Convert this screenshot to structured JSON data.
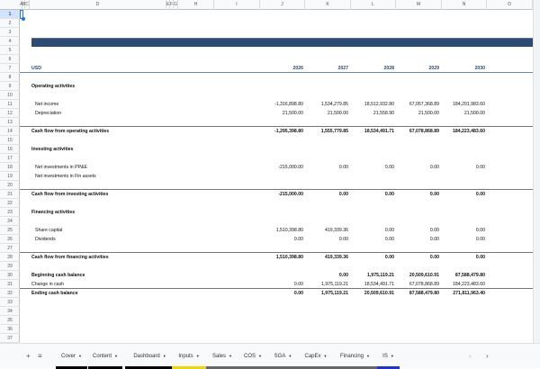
{
  "columns": [
    "A",
    "B",
    "C",
    "D",
    "E",
    "F",
    "G",
    "H",
    "I",
    "J",
    "K",
    "L",
    "M",
    "N",
    "O"
  ],
  "row_numbers": [
    1,
    2,
    3,
    4,
    5,
    6,
    7,
    8,
    9,
    10,
    11,
    12,
    13,
    14,
    15,
    16,
    17,
    18,
    19,
    20,
    21,
    22,
    23,
    24,
    25,
    26,
    27,
    28,
    29,
    30,
    31,
    32,
    33,
    34,
    35,
    36,
    37
  ],
  "title": "CASH FLOW",
  "currency": "USD",
  "years": [
    "2026",
    "2027",
    "2028",
    "2029",
    "2030"
  ],
  "rows": [
    {
      "r": 9,
      "label": "Operating activities",
      "bold": true
    },
    {
      "r": 11,
      "label": "Net income",
      "indent": true,
      "values": [
        "-1,316,898.80",
        "1,534,279.85",
        "18,512,932.80",
        "67,057,368.89",
        "184,201,983.60"
      ]
    },
    {
      "r": 12,
      "label": "Depreciation",
      "indent": true,
      "values": [
        "21,500.00",
        "21,500.00",
        "21,558.90",
        "21,500.00",
        "21,500.00"
      ]
    },
    {
      "r": 14,
      "label": "Cash flow from operating activities",
      "bold": true,
      "line": true,
      "values": [
        "-1,295,398.80",
        "1,555,779.85",
        "18,534,491.71",
        "67,078,868.89",
        "184,223,483.60"
      ]
    },
    {
      "r": 16,
      "label": "Investing activities",
      "bold": true
    },
    {
      "r": 18,
      "label": "Net investments in PP&E",
      "indent": true,
      "values": [
        "-215,000.00",
        "0.00",
        "0.00",
        "0.00",
        "0.00"
      ]
    },
    {
      "r": 19,
      "label": "Net investments in Fin assets",
      "indent": true
    },
    {
      "r": 21,
      "label": "Cash flow from investing activities",
      "bold": true,
      "line": true,
      "values": [
        "-215,000.00",
        "0.00",
        "0.00",
        "0.00",
        "0.00"
      ]
    },
    {
      "r": 23,
      "label": "Financing activities",
      "bold": true
    },
    {
      "r": 25,
      "label": "Share capital",
      "indent": true,
      "values": [
        "1,510,398.80",
        "419,339.36",
        "0.00",
        "0.00",
        "0.00"
      ]
    },
    {
      "r": 26,
      "label": "Dividends",
      "indent": true,
      "values": [
        "0.00",
        "0.00",
        "0.00",
        "0.00",
        "0.00"
      ]
    },
    {
      "r": 28,
      "label": "Cash flow from financing activities",
      "bold": true,
      "line": true,
      "values": [
        "1,510,398.80",
        "419,339.36",
        "0.00",
        "0.00",
        "0.00"
      ]
    },
    {
      "r": 30,
      "label": "Beginning cash balance",
      "bold": true,
      "values": [
        "",
        "0.00",
        "1,975,119.21",
        "20,509,610.91",
        "87,588,479.80"
      ]
    },
    {
      "r": 31,
      "label": "Change in cash",
      "values": [
        "0.00",
        "1,975,119.21",
        "18,534,491.71",
        "67,078,868.89",
        "184,223,483.60"
      ]
    },
    {
      "r": 32,
      "label": "Ending cash balance",
      "bold": true,
      "line": true,
      "values": [
        "0.00",
        "1,975,119.21",
        "20,509,610.91",
        "87,588,479.80",
        "271,811,963.40"
      ]
    }
  ],
  "tabs": [
    {
      "label": "Cover",
      "color": "#000000"
    },
    {
      "label": "Content",
      "color": "#000000"
    },
    {
      "label": "Dashboard",
      "color": "#000000"
    },
    {
      "label": "Inputs",
      "color": "#f4d400"
    },
    {
      "label": "Sales",
      "color": "#666666"
    },
    {
      "label": "COS",
      "color": "#666666"
    },
    {
      "label": "SGA",
      "color": "#666666"
    },
    {
      "label": "CapEx",
      "color": "#666666"
    },
    {
      "label": "Financing",
      "color": "#666666"
    },
    {
      "label": "IS",
      "color": "#1a35d6"
    }
  ],
  "tabbar": {
    "add": "+",
    "menu": "≡",
    "prev": "‹",
    "next": "›",
    "caret": "▼"
  }
}
